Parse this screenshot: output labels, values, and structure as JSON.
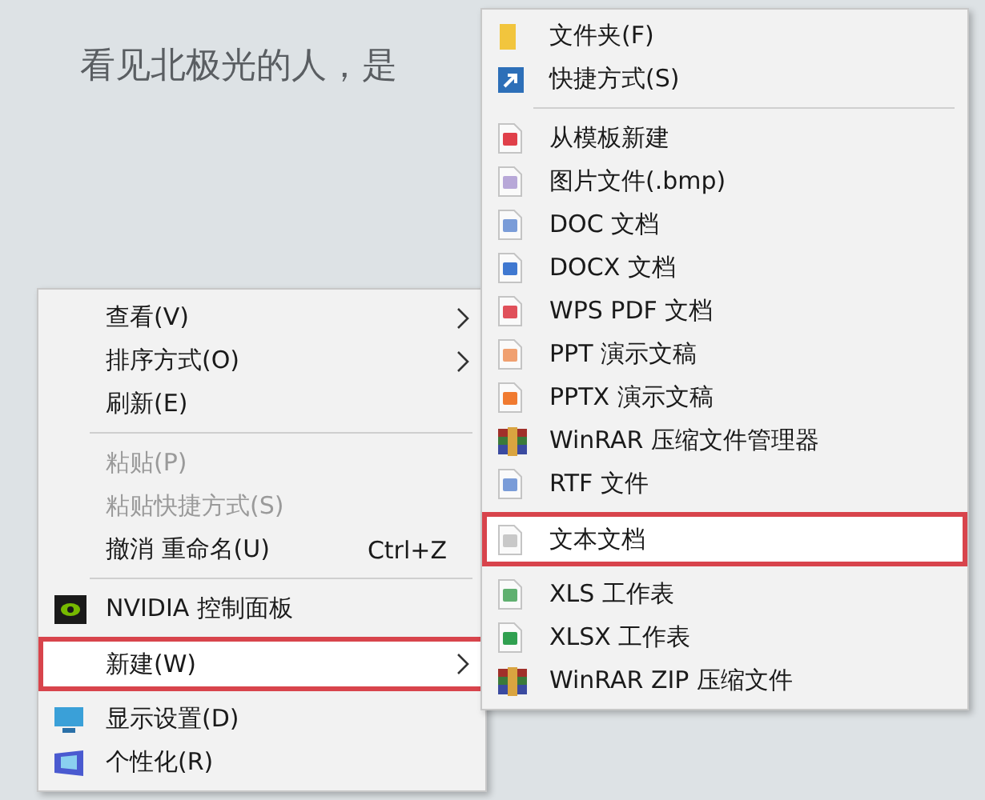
{
  "desktop": {
    "heading": "看见北极光的人，是"
  },
  "context_menu": {
    "items": [
      {
        "kind": "plain",
        "label": "查看(V)",
        "has_submenu": true,
        "disabled": false,
        "selected": false
      },
      {
        "kind": "plain",
        "label": "排序方式(O)",
        "has_submenu": true,
        "disabled": false,
        "selected": false
      },
      {
        "kind": "plain",
        "label": "刷新(E)",
        "has_submenu": false,
        "disabled": false,
        "selected": false
      },
      {
        "kind": "separator"
      },
      {
        "kind": "plain",
        "label": "粘贴(P)",
        "has_submenu": false,
        "disabled": true,
        "selected": false
      },
      {
        "kind": "plain",
        "label": "粘贴快捷方式(S)",
        "has_submenu": false,
        "disabled": true,
        "selected": false
      },
      {
        "kind": "plain",
        "label": "撤消 重命名(U)",
        "shortcut": "Ctrl+Z",
        "has_submenu": false,
        "disabled": false,
        "selected": false
      },
      {
        "kind": "separator"
      },
      {
        "kind": "gpu",
        "label": "NVIDIA 控制面板",
        "has_submenu": false,
        "disabled": false,
        "selected": false
      },
      {
        "kind": "plain",
        "label": "新建(W)",
        "has_submenu": true,
        "disabled": false,
        "selected": true
      },
      {
        "kind": "monitor",
        "label": "显示设置(D)",
        "has_submenu": false,
        "disabled": false,
        "selected": false
      },
      {
        "kind": "palette",
        "label": "个性化(R)",
        "has_submenu": false,
        "disabled": false,
        "selected": false
      }
    ]
  },
  "new_submenu": {
    "items": [
      {
        "kind": "folder",
        "label": "文件夹(F)",
        "selected": false
      },
      {
        "kind": "shortcut",
        "label": "快捷方式(S)",
        "selected": false
      },
      {
        "kind": "separator"
      },
      {
        "kind": "file",
        "color": "#e0404a",
        "label": "从模板新建",
        "selected": false
      },
      {
        "kind": "file",
        "color": "#b8a8d8",
        "label": "图片文件(.bmp)",
        "selected": false
      },
      {
        "kind": "file",
        "color": "#7a9cd8",
        "label": "DOC 文档",
        "selected": false
      },
      {
        "kind": "file",
        "color": "#3f78d0",
        "label": "DOCX 文档",
        "selected": false
      },
      {
        "kind": "file",
        "color": "#e0505a",
        "label": "WPS PDF 文档",
        "selected": false
      },
      {
        "kind": "file",
        "color": "#f0a070",
        "label": "PPT 演示文稿",
        "selected": false
      },
      {
        "kind": "file",
        "color": "#f07a30",
        "label": "PPTX 演示文稿",
        "selected": false
      },
      {
        "kind": "archive",
        "label": "WinRAR 压缩文件管理器",
        "selected": false
      },
      {
        "kind": "file",
        "color": "#7a9cd8",
        "label": "RTF 文件",
        "selected": false
      },
      {
        "kind": "file",
        "color": "#c8c8c8",
        "label": "文本文档",
        "selected": true
      },
      {
        "kind": "file",
        "color": "#60b070",
        "label": "XLS 工作表",
        "selected": false
      },
      {
        "kind": "file",
        "color": "#30a050",
        "label": "XLSX 工作表",
        "selected": false
      },
      {
        "kind": "archive",
        "label": "WinRAR ZIP 压缩文件",
        "selected": false
      }
    ]
  }
}
